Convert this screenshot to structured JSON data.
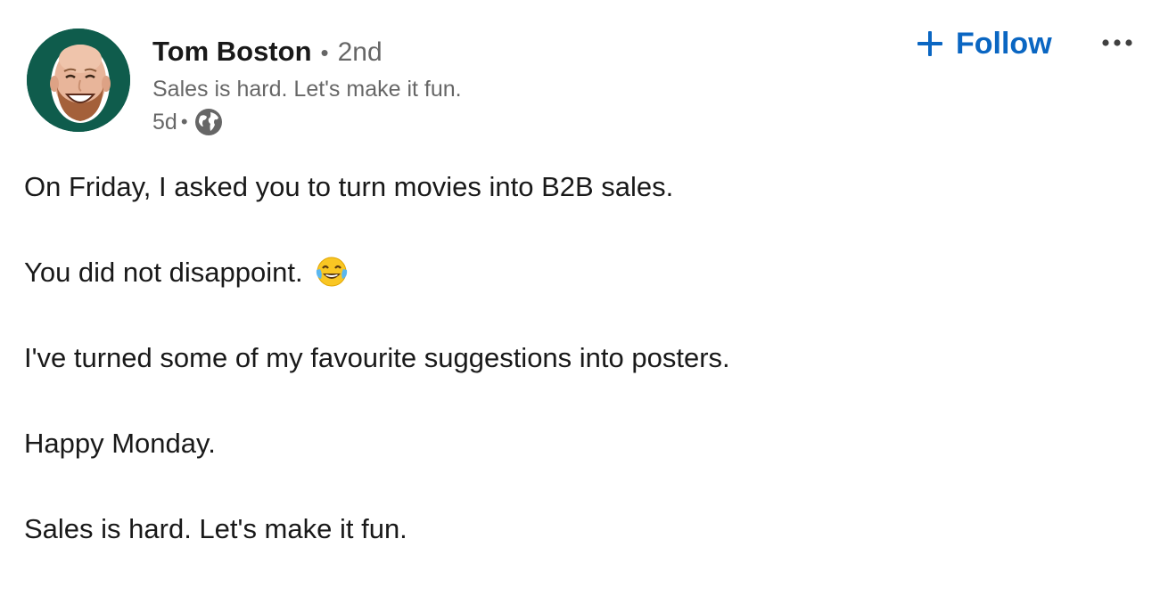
{
  "author": {
    "name": "Tom Boston",
    "connection_degree": "2nd",
    "separator": "•",
    "headline": "Sales is hard. Let's make it fun.",
    "posted_ago": "5d",
    "visibility_icon": "globe-icon",
    "avatar_bg": "#0f5c4c"
  },
  "actions": {
    "follow_label": "Follow",
    "follow_icon": "plus-icon",
    "more_icon": "ellipsis-icon",
    "accent": "#0a66c2"
  },
  "post": {
    "paragraphs": [
      "On Friday, I asked you to turn movies into B2B sales.",
      "You did not disappoint.",
      "I've turned some of my favourite suggestions into posters.",
      "Happy Monday.",
      "Sales is hard. Let's make it fun."
    ],
    "emoji": "face-with-tears-of-joy-icon"
  }
}
